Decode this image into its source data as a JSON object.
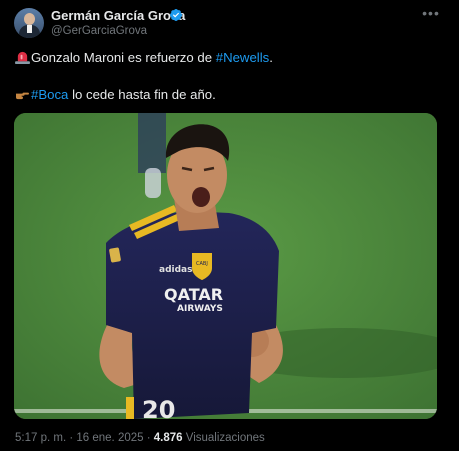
{
  "author": {
    "name": "Germán García Grova",
    "handle": "@GerGarciaGrova",
    "verified": true
  },
  "tweet": {
    "line1_emoji": "rotating-light-emoji",
    "line1_text": "Gonzalo Maroni es refuerzo de ",
    "line1_hashtag": "#Newells",
    "line1_after": ".",
    "line2_emoji": "pointing-hand-emoji",
    "line2_hashtag": "#Boca",
    "line2_text": " lo cede hasta fin de año."
  },
  "media": {
    "jersey_sponsor_line1": "QATAR",
    "jersey_sponsor_line2": "AIRWAYS",
    "jersey_brand": "adidas",
    "jersey_number": "20",
    "crest_text": "CABJ"
  },
  "meta": {
    "time": "5:17 p. m.",
    "separator1": " · ",
    "date": "16 ene. 2025",
    "separator2": " · ",
    "views": "4.876",
    "views_label": " Visualizaciones"
  },
  "colors": {
    "background": "#000000",
    "text": "#e7e9ea",
    "secondary": "#71767b",
    "link": "#1d9bf0",
    "verified": "#1d9bf0"
  }
}
